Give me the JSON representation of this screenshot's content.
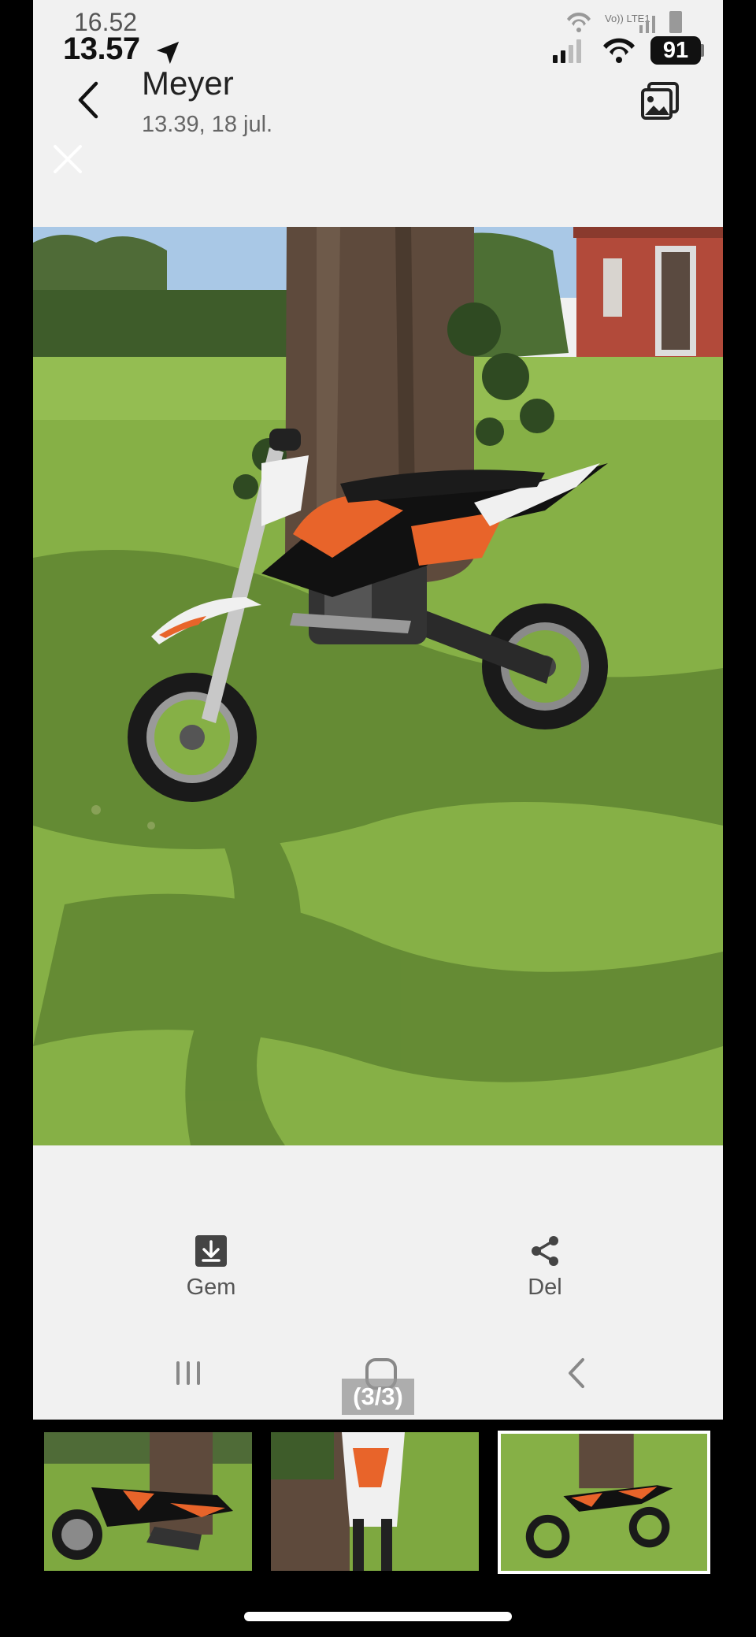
{
  "status_bar": {
    "time_under": "16.52",
    "time": "13.57",
    "network_under": "Vo)) LTE1",
    "battery": "91"
  },
  "header": {
    "title": "Meyer",
    "subtitle": "13.39, 18 jul."
  },
  "actions": {
    "save_label": "Gem",
    "share_label": "Del"
  },
  "viewer": {
    "counter": "(3/3)"
  },
  "icons": {
    "back": "chevron-left-icon",
    "gallery": "image-gallery-icon",
    "close": "close-icon",
    "save": "download-icon",
    "share": "share-icon"
  },
  "colors": {
    "screen_background": "#f1f1f1",
    "grass": "#7faa3d",
    "bike_orange": "#e8642a"
  }
}
